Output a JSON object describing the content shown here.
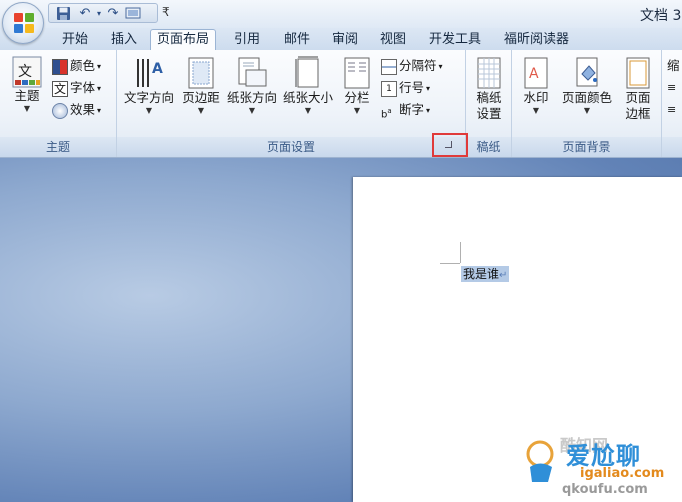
{
  "window": {
    "title": "文档 3"
  },
  "tabs": [
    "开始",
    "插入",
    "页面布局",
    "引用",
    "邮件",
    "审阅",
    "视图",
    "开发工具",
    "福昕阅读器"
  ],
  "active_tab": "页面布局",
  "ribbon": {
    "theme_group": {
      "label": "主题",
      "theme_button": "主题",
      "theme_icon_text": "文",
      "colors": "颜色",
      "fonts_icon_text": "文",
      "fonts": "字体",
      "effects": "效果"
    },
    "page_setup_group": {
      "label": "页面设置",
      "text_direction": "文字方向",
      "margins": "页边距",
      "orientation": "纸张方向",
      "size": "纸张大小",
      "columns": "分栏",
      "breaks": "分隔符",
      "line_numbers": "行号",
      "hyphenation": "断字"
    },
    "draft_paper_group": {
      "label": "稿纸",
      "button_line1": "稿纸",
      "button_line2": "设置"
    },
    "page_background_group": {
      "label": "页面背景",
      "watermark": "水印",
      "page_color": "页面颜色",
      "borders_line1": "页面",
      "borders_line2": "边框"
    },
    "indent_group": {
      "label_partial": "缩"
    }
  },
  "document": {
    "selected_text": "我是谁"
  },
  "watermark": {
    "line1": "爱尬聊",
    "line2": "igaliao.com",
    "line3": "qkoufu.com",
    "brand": "酷知网"
  }
}
